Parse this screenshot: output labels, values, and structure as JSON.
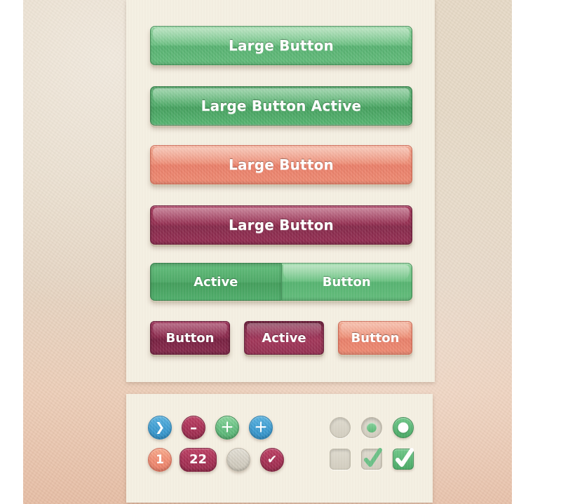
{
  "theme": {
    "backdrop_color": "#e6d9c6",
    "backdrop_bottom_color": "#e6bda4",
    "panel_color": "#f4efe2",
    "green": "#6cc183",
    "green_active": "#51ab6a",
    "salmon": "#ef8f78",
    "maroon": "#962f52",
    "maroon_dark": "#8b2a4d",
    "blue": "#3f9fd4",
    "gray": "#d6d1c5"
  },
  "buttons_panel": {
    "name": "buttons-panel",
    "large_buttons": [
      {
        "label": "Large Button",
        "style": "green",
        "state": "normal"
      },
      {
        "label": "Large Button Active",
        "style": "green-active",
        "state": "active"
      },
      {
        "label": "Large Button",
        "style": "salmon",
        "state": "normal"
      },
      {
        "label": "Large Button",
        "style": "maroon",
        "state": "normal"
      }
    ],
    "segmented": {
      "segments": [
        {
          "label": "Active",
          "style": "green-active",
          "state": "active"
        },
        {
          "label": "Button",
          "style": "green",
          "state": "normal"
        }
      ]
    },
    "small_buttons": [
      {
        "label": "Button",
        "style": "maroon-dark",
        "state": "normal"
      },
      {
        "label": "Active",
        "style": "maroon-dark",
        "state": "active"
      },
      {
        "label": "Button",
        "style": "salmon",
        "state": "normal"
      }
    ]
  },
  "controls_panel": {
    "name": "controls-panel",
    "badges_row1": [
      {
        "glyph": "❯",
        "icon": "chevron-right-icon",
        "color": "blue",
        "shape": "circle"
      },
      {
        "glyph": "–",
        "icon": "minus-icon",
        "color": "crimson",
        "shape": "circle"
      },
      {
        "glyph": "＋",
        "icon": "plus-icon",
        "color": "green",
        "shape": "circle"
      },
      {
        "glyph": "＋",
        "icon": "plus-icon",
        "color": "blue",
        "shape": "circle"
      }
    ],
    "badges_row2": [
      {
        "glyph": "1",
        "icon": "count-badge",
        "color": "orange",
        "shape": "circle"
      },
      {
        "glyph": "22",
        "icon": "count-badge",
        "color": "crimson",
        "shape": "pill"
      },
      {
        "glyph": "",
        "icon": "empty-badge",
        "color": "gray",
        "shape": "circle"
      },
      {
        "glyph": "✔",
        "icon": "check-icon",
        "color": "crimson",
        "shape": "circle"
      }
    ],
    "radios": [
      {
        "icon": "radio-unchecked-icon",
        "state": "off"
      },
      {
        "icon": "radio-partial-icon",
        "state": "selected"
      },
      {
        "icon": "radio-checked-icon",
        "state": "on"
      }
    ],
    "checkboxes": [
      {
        "icon": "checkbox-unchecked-icon",
        "state": "off"
      },
      {
        "icon": "checkbox-hover-icon",
        "state": "half"
      },
      {
        "icon": "checkbox-checked-icon",
        "state": "on"
      }
    ]
  }
}
